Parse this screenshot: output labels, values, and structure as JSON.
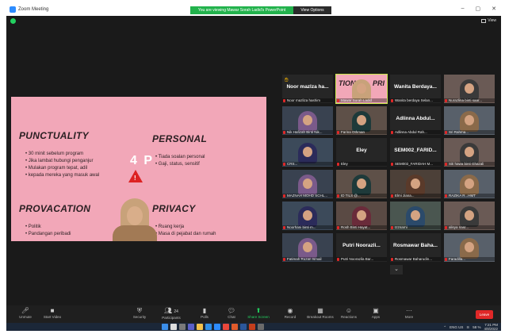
{
  "window": {
    "title": "Zoom Meeting",
    "banner": "You are viewing Mawar Sorah Ladid's PowerPoint",
    "view_options": "View Options",
    "view_label": "View"
  },
  "slide": {
    "h1": "PUNCTUALITY",
    "h1_items": [
      "30 minit sebelum program",
      "Jika lambat hubungi penganjur",
      "Mulakan program tepat, adil",
      "kepada mereka yang masuk awal"
    ],
    "h2": "PERSONAL",
    "h2_items": [
      "Tiada soalan personal",
      "Gaji, status, sensitif"
    ],
    "center": "4 P",
    "h3": "PROVACATION",
    "h3_items": [
      "Politik",
      "Pandangan peribadi"
    ],
    "h4": "PRIVACY",
    "h4_items": [
      "Ruang kerja",
      "Masa di pejabat dan rumah"
    ]
  },
  "gallery": {
    "tiles": [
      {
        "big": "Noor mazlza ha...",
        "name": "Noor mazliza hashim",
        "hand": true
      },
      {
        "tion": "TION",
        "pri": "PRI",
        "name": "Mawar Sorah Ladid",
        "active": true
      },
      {
        "big": "Wanita Berdaya...",
        "name": "Wanita berdaya Selan..."
      },
      {
        "name": "Nurazlina binti saar..."
      },
      {
        "name": "Nik Hafizah Binti Nik..."
      },
      {
        "name": "Farina Othman"
      },
      {
        "big": "Adlinna Abdul...",
        "name": "Adlinna Abdul Rah..."
      },
      {
        "name": "Sri Rahma..."
      },
      {
        "name": "CRS..."
      },
      {
        "big": "Eley",
        "name": "Eley"
      },
      {
        "big": "SEM002_FARID...",
        "name": "SEM002_FARIDAH M..."
      },
      {
        "name": "Siti hawa binti Ghazali"
      },
      {
        "name": "MAZNAH MOHD SCHL..."
      },
      {
        "name": "ID TILS @..."
      },
      {
        "name": "Elmi Jiana..."
      },
      {
        "name": "RAZIKA R...HMT"
      },
      {
        "name": "Noorhani binti m..."
      },
      {
        "name": "Rosh Binti Hayat..."
      },
      {
        "name": "Izznarni"
      },
      {
        "name": "alisya nasr..."
      },
      {
        "name": "Fatimah Ruzan Ismail"
      },
      {
        "big": "Putri Noorazli...",
        "name": "Putri Noorazila Bar..."
      },
      {
        "big": "Rosmawar Baha...",
        "name": "Rosmawar Baharudin..."
      },
      {
        "name": "Faradilla..."
      }
    ]
  },
  "toolbar": {
    "unmute": "Unmute",
    "start_video": "Start Video",
    "security": "Security",
    "participants": "Participants",
    "participants_count": "24",
    "polls": "Polls",
    "chat": "Chat",
    "share_screen": "Share Screen",
    "record": "Record",
    "breakout": "Breakout Rooms",
    "reactions": "Reactions",
    "apps": "Apps",
    "more": "More",
    "leave": "Leave"
  },
  "taskbar": {
    "lang": "ENG",
    "region": "US",
    "battery": "58 %",
    "time": "7:21 PM",
    "date": "4/8/2022"
  },
  "colors": {
    "slide_bg": "#f2a7b8",
    "share_green": "#22b24c",
    "leave_red": "#e02828",
    "active_border": "#c8e64a"
  }
}
